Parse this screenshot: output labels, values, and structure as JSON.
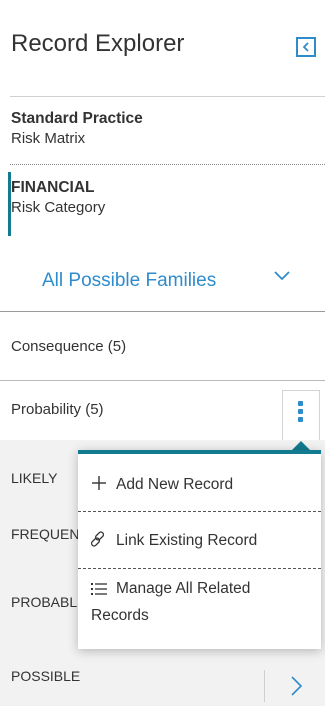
{
  "header": {
    "title": "Record Explorer",
    "collapse_icon": "chevron-left-icon"
  },
  "breadcrumbs": [
    {
      "title": "Standard Practice",
      "subtitle": "Risk Matrix",
      "active": false
    },
    {
      "title": "FINANCIAL",
      "subtitle": "Risk Category",
      "active": true
    }
  ],
  "families": {
    "label": "All Possible Families",
    "icon": "chevron-down-icon"
  },
  "groups": [
    {
      "label": "Consequence (5)"
    },
    {
      "label": "Probability (5)"
    }
  ],
  "records": [
    {
      "label": "LIKELY"
    },
    {
      "label": "FREQUEN"
    },
    {
      "label": "PROBABL"
    },
    {
      "label": "POSSIBLE"
    }
  ],
  "menu": {
    "items": [
      {
        "icon": "plus-icon",
        "label": "Add New Record"
      },
      {
        "icon": "link-icon",
        "label": "Link Existing Record"
      },
      {
        "icon": "list-icon",
        "label_line1": "Manage All Related",
        "label_line2": "Records"
      }
    ]
  },
  "colors": {
    "accent": "#2f8ccc",
    "teal": "#127b8f",
    "text": "#333333",
    "list_bg": "#f2f2f2"
  }
}
